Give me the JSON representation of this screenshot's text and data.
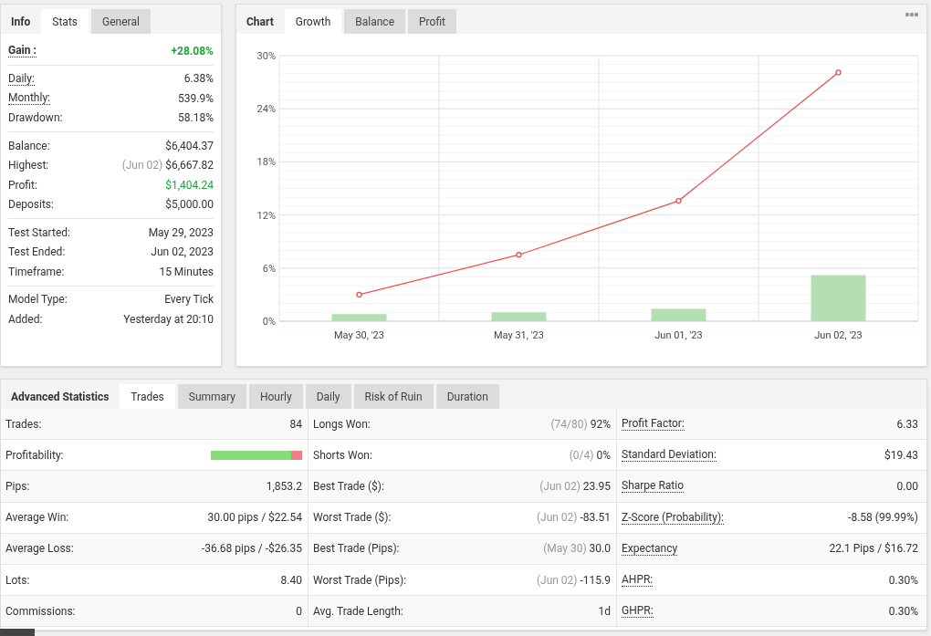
{
  "info_panel": {
    "tabs": [
      {
        "label": "Info",
        "kind": "title"
      },
      {
        "label": "Stats",
        "selected": true,
        "kind": "tab"
      },
      {
        "label": "General",
        "selected": false,
        "kind": "tab"
      }
    ],
    "groups": [
      [
        {
          "label": "Gain :",
          "value": "+28.08%",
          "dotted": true,
          "bold": true,
          "positive": true
        }
      ],
      [
        {
          "label": "Daily:",
          "value": "6.38%",
          "dotted": true,
          "bold": false,
          "positive": false
        },
        {
          "label": "Monthly:",
          "value": "539.9%",
          "dotted": true,
          "bold": false,
          "positive": false
        },
        {
          "label": "Drawdown:",
          "value": "58.18%",
          "dotted": false,
          "bold": false,
          "positive": false
        }
      ],
      [
        {
          "label": "Balance:",
          "value": "$6,404.37",
          "dotted": false,
          "bold": false,
          "positive": false
        },
        {
          "label": "Highest:",
          "note": "(Jun 02)",
          "value": "$6,667.82",
          "dotted": false,
          "bold": false,
          "positive": false
        },
        {
          "label": "Profit:",
          "value": "$1,404.24",
          "dotted": false,
          "bold": false,
          "positive": true
        },
        {
          "label": "Deposits:",
          "value": "$5,000.00",
          "dotted": false,
          "bold": false,
          "positive": false
        }
      ],
      [
        {
          "label": "Test Started:",
          "value": "May 29, 2023",
          "dotted": false,
          "bold": false,
          "positive": false
        },
        {
          "label": "Test Ended:",
          "value": "Jun 02, 2023",
          "dotted": false,
          "bold": false,
          "positive": false
        },
        {
          "label": "Timeframe:",
          "value": "15 Minutes",
          "dotted": false,
          "bold": false,
          "positive": false
        }
      ],
      [
        {
          "label": "Model Type:",
          "value": "Every Tick",
          "dotted": false,
          "bold": false,
          "positive": false
        },
        {
          "label": "Added:",
          "value": "Yesterday at 20:10",
          "dotted": false,
          "bold": false,
          "positive": false
        }
      ]
    ]
  },
  "chart_panel": {
    "tabs": [
      {
        "label": "Chart",
        "kind": "title"
      },
      {
        "label": "Growth",
        "selected": true,
        "kind": "tab"
      },
      {
        "label": "Balance",
        "selected": false,
        "kind": "tab"
      },
      {
        "label": "Profit",
        "selected": false,
        "kind": "tab"
      }
    ],
    "chart_data": {
      "type": "line",
      "categories": [
        "May 30, '23",
        "May 31, '23",
        "Jun 01, '23",
        "Jun 02, '23"
      ],
      "series": [
        {
          "type": "line",
          "marker": true,
          "color": "#e8534f",
          "values": [
            3.0,
            7.5,
            13.6,
            28.1
          ]
        },
        {
          "type": "bar",
          "color": "#b3dfb3",
          "values": [
            0.8,
            1.0,
            1.4,
            5.2
          ]
        }
      ],
      "grid": true,
      "ylim": [
        0,
        30
      ],
      "yticks": [
        {
          "value": 0,
          "label": "0%"
        },
        {
          "value": 6,
          "label": "6%"
        },
        {
          "value": 12,
          "label": "12%"
        },
        {
          "value": 18,
          "label": "18%"
        },
        {
          "value": 24,
          "label": "24%"
        },
        {
          "value": 30,
          "label": "30%"
        }
      ]
    }
  },
  "advanced": {
    "tabs": [
      {
        "label": "Advanced Statistics",
        "kind": "title"
      },
      {
        "label": "Trades",
        "selected": true,
        "kind": "tab"
      },
      {
        "label": "Summary",
        "selected": false,
        "kind": "tab"
      },
      {
        "label": "Hourly",
        "selected": false,
        "kind": "tab"
      },
      {
        "label": "Daily",
        "selected": false,
        "kind": "tab"
      },
      {
        "label": "Risk of Ruin",
        "selected": false,
        "kind": "tab"
      },
      {
        "label": "Duration",
        "selected": false,
        "kind": "tab"
      }
    ],
    "rows": [
      [
        {
          "label": "Trades:",
          "value": "84",
          "kind": "text",
          "dotted": false
        },
        {
          "label": "Longs Won:",
          "note": "(74/80)",
          "value": "92%",
          "kind": "text",
          "dotted": false
        },
        {
          "label": "Profit Factor:",
          "value": "6.33",
          "kind": "text",
          "dotted": true
        }
      ],
      [
        {
          "label": "Profitability:",
          "level": 0.88,
          "kind": "bar",
          "dotted": false
        },
        {
          "label": "Shorts Won:",
          "note": "(0/4)",
          "value": "0%",
          "kind": "text",
          "dotted": false
        },
        {
          "label": "Standard Deviation:",
          "value": "$19.43",
          "kind": "text",
          "dotted": true
        }
      ],
      [
        {
          "label": "Pips:",
          "value": "1,853.2",
          "kind": "text",
          "dotted": false
        },
        {
          "label": "Best Trade ($):",
          "note": "(Jun 02)",
          "value": "23.95",
          "kind": "text",
          "dotted": false
        },
        {
          "label": "Sharpe Ratio",
          "value": "0.00",
          "kind": "text",
          "dotted": true
        }
      ],
      [
        {
          "label": "Average Win:",
          "value": "30.00 pips / $22.54",
          "kind": "text",
          "dotted": false
        },
        {
          "label": "Worst Trade ($):",
          "note": "(Jun 02)",
          "value": "-83.51",
          "kind": "text",
          "dotted": false
        },
        {
          "label": "Z-Score (Probability):",
          "value": "-8.58 (99.99%)",
          "kind": "text",
          "dotted": true
        }
      ],
      [
        {
          "label": "Average Loss:",
          "value": "-36.68 pips / -$26.35",
          "kind": "text",
          "dotted": false
        },
        {
          "label": "Best Trade (Pips):",
          "note": "(May 30)",
          "value": "30.0",
          "kind": "text",
          "dotted": false
        },
        {
          "label": "Expectancy",
          "value": "22.1 Pips / $16.72",
          "kind": "text",
          "dotted": true
        }
      ],
      [
        {
          "label": "Lots:",
          "value": "8.40",
          "kind": "text",
          "dotted": false
        },
        {
          "label": "Worst Trade (Pips):",
          "note": "(Jun 02)",
          "value": "-115.9",
          "kind": "text",
          "dotted": false
        },
        {
          "label": "AHPR:",
          "value": "0.30%",
          "kind": "text",
          "dotted": true
        }
      ],
      [
        {
          "label": "Commissions:",
          "value": "0",
          "kind": "text",
          "dotted": false
        },
        {
          "label": "Avg. Trade Length:",
          "value": "1d",
          "kind": "text",
          "dotted": false
        },
        {
          "label": "GHPR:",
          "value": "0.30%",
          "kind": "text",
          "dotted": true
        }
      ]
    ]
  }
}
